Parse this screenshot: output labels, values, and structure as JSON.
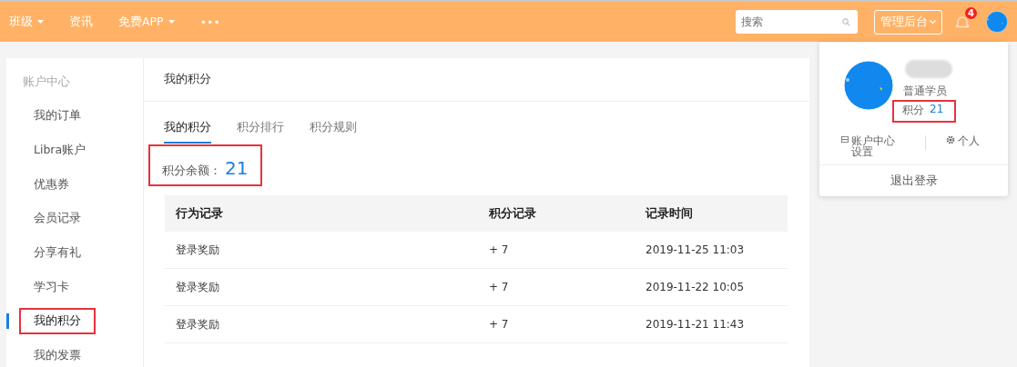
{
  "topnav": {
    "items": [
      {
        "label": "班级",
        "dropdown": true
      },
      {
        "label": "资讯",
        "dropdown": false
      },
      {
        "label": "免费APP",
        "dropdown": true
      },
      {
        "label": "•••",
        "dropdown": false
      }
    ],
    "search": {
      "placeholder": "搜索"
    },
    "admin_button": "管理后台",
    "notification_count": "4"
  },
  "sidebar": {
    "title": "账户中心",
    "items": [
      {
        "label": "我的订单",
        "selected": false,
        "highlighted": false
      },
      {
        "label": "Libra账户",
        "selected": false,
        "highlighted": false
      },
      {
        "label": "优惠券",
        "selected": false,
        "highlighted": false
      },
      {
        "label": "会员记录",
        "selected": false,
        "highlighted": false
      },
      {
        "label": "分享有礼",
        "selected": false,
        "highlighted": false
      },
      {
        "label": "学习卡",
        "selected": false,
        "highlighted": false
      },
      {
        "label": "我的积分",
        "selected": true,
        "highlighted": true
      },
      {
        "label": "我的发票",
        "selected": false,
        "highlighted": false
      }
    ]
  },
  "main": {
    "title": "我的积分",
    "tabs": [
      {
        "label": "我的积分",
        "selected": true
      },
      {
        "label": "积分排行",
        "selected": false
      },
      {
        "label": "积分规则",
        "selected": false
      }
    ],
    "balance": {
      "label": "积分余额：",
      "value": "21",
      "highlighted": true
    },
    "table": {
      "columns": [
        "行为记录",
        "积分记录",
        "记录时间"
      ],
      "rows": [
        [
          "登录奖励",
          "+ 7",
          "2019-11-25 11:03"
        ],
        [
          "登录奖励",
          "+ 7",
          "2019-11-22 10:05"
        ],
        [
          "登录奖励",
          "+ 7",
          "2019-11-21 11:43"
        ]
      ]
    }
  },
  "user_menu": {
    "role": "普通学员",
    "points_label": "积分",
    "points": "21",
    "points_highlighted": true,
    "links": [
      {
        "label": "账户中心设置",
        "kind": "panel"
      },
      {
        "label": "个人",
        "kind": "gear"
      }
    ],
    "logout": "退出登录"
  }
}
